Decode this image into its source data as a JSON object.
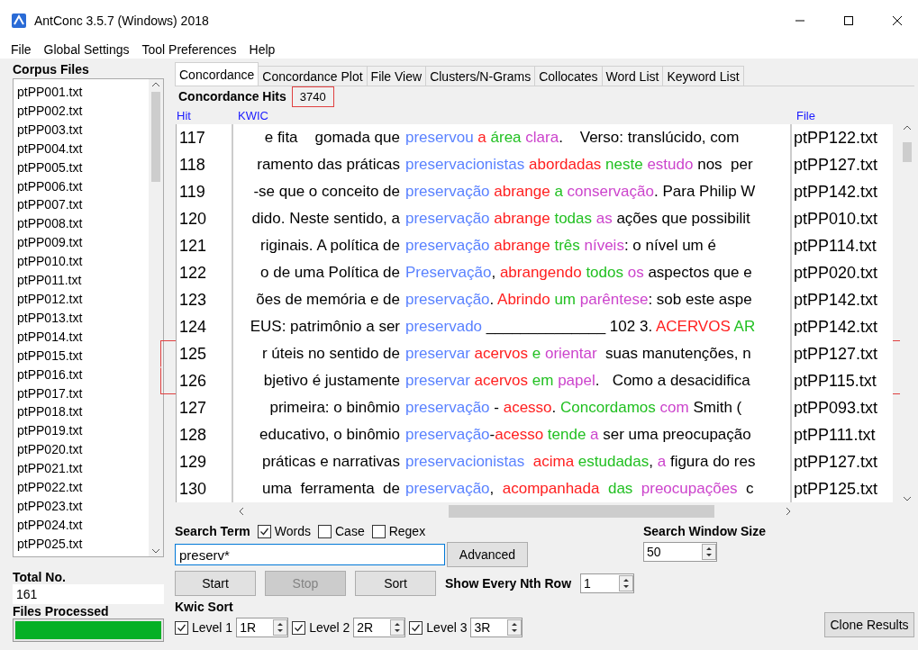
{
  "window": {
    "title": "AntConc 3.5.7 (Windows) 2018"
  },
  "menu": [
    "File",
    "Global Settings",
    "Tool Preferences",
    "Help"
  ],
  "corpus": {
    "title": "Corpus Files",
    "files": [
      "ptPP001.txt",
      "ptPP002.txt",
      "ptPP003.txt",
      "ptPP004.txt",
      "ptPP005.txt",
      "ptPP006.txt",
      "ptPP007.txt",
      "ptPP008.txt",
      "ptPP009.txt",
      "ptPP010.txt",
      "ptPP011.txt",
      "ptPP012.txt",
      "ptPP013.txt",
      "ptPP014.txt",
      "ptPP015.txt",
      "ptPP016.txt",
      "ptPP017.txt",
      "ptPP018.txt",
      "ptPP019.txt",
      "ptPP020.txt",
      "ptPP021.txt",
      "ptPP022.txt",
      "ptPP023.txt",
      "ptPP024.txt",
      "ptPP025.txt"
    ],
    "total_label": "Total No.",
    "total": "161",
    "processed_label": "Files Processed",
    "progress": {
      "level": 1
    }
  },
  "tabs": [
    {
      "label": "Concordance",
      "selected": true
    },
    {
      "label": "Concordance Plot",
      "selected": false
    },
    {
      "label": "File View",
      "selected": false
    },
    {
      "label": "Clusters/N-Grams",
      "selected": false
    },
    {
      "label": "Collocates",
      "selected": false
    },
    {
      "label": "Word List",
      "selected": false
    },
    {
      "label": "Keyword List",
      "selected": false
    }
  ],
  "hits": {
    "label": "Concordance Hits",
    "count": "3740",
    "highlighted": true
  },
  "columns": [
    "Hit",
    "KWIC",
    "File"
  ],
  "rows": [
    {
      "hit": "117",
      "left": "e fita    gomada que",
      "right": [
        {
          "text": "preservou ",
          "color": "#5a82ff"
        },
        {
          "text": "a ",
          "color": "#ff2020"
        },
        {
          "text": "área ",
          "color": "#22c022"
        },
        {
          "text": "clara",
          "color": "#cc44cc"
        },
        {
          "text": ".    Verso: translúcido, com"
        }
      ],
      "file": "ptPP122.txt",
      "highlighted": false
    },
    {
      "hit": "118",
      "left": "ramento das práticas",
      "right": [
        {
          "text": "preservacionistas ",
          "color": "#5a82ff"
        },
        {
          "text": "abordadas ",
          "color": "#ff2020"
        },
        {
          "text": "neste ",
          "color": "#22c022"
        },
        {
          "text": "estudo",
          "color": "#cc44cc"
        },
        {
          "text": " nos  per"
        }
      ],
      "file": "ptPP127.txt",
      "highlighted": false
    },
    {
      "hit": "119",
      "left": "-se que o conceito de",
      "right": [
        {
          "text": "preservação ",
          "color": "#5a82ff"
        },
        {
          "text": "abrange ",
          "color": "#ff2020"
        },
        {
          "text": "a ",
          "color": "#22c022"
        },
        {
          "text": "conservação",
          "color": "#cc44cc"
        },
        {
          "text": ". Para Philip W"
        }
      ],
      "file": "ptPP142.txt",
      "highlighted": false
    },
    {
      "hit": "120",
      "left": "dido. Neste sentido, a",
      "right": [
        {
          "text": "preservação ",
          "color": "#5a82ff"
        },
        {
          "text": "abrange ",
          "color": "#ff2020"
        },
        {
          "text": "todas ",
          "color": "#22c022"
        },
        {
          "text": "as",
          "color": "#cc44cc"
        },
        {
          "text": " ações que possibilit"
        }
      ],
      "file": "ptPP010.txt",
      "highlighted": false
    },
    {
      "hit": "121",
      "left": "riginais. A política de",
      "right": [
        {
          "text": "preservação ",
          "color": "#5a82ff"
        },
        {
          "text": "abrange ",
          "color": "#ff2020"
        },
        {
          "text": "três ",
          "color": "#22c022"
        },
        {
          "text": "níveis",
          "color": "#cc44cc"
        },
        {
          "text": ": o nível um é"
        }
      ],
      "file": "ptPP114.txt",
      "highlighted": false
    },
    {
      "hit": "122",
      "left": "o de uma Política de",
      "right": [
        {
          "text": "Preservação",
          "color": "#5a82ff"
        },
        {
          "text": ", "
        },
        {
          "text": "abrangendo ",
          "color": "#ff2020"
        },
        {
          "text": "todos ",
          "color": "#22c022"
        },
        {
          "text": "os",
          "color": "#cc44cc"
        },
        {
          "text": " aspectos que e"
        }
      ],
      "file": "ptPP020.txt",
      "highlighted": false
    },
    {
      "hit": "123",
      "left": "ões de memória e de",
      "right": [
        {
          "text": "preservação",
          "color": "#5a82ff"
        },
        {
          "text": ". "
        },
        {
          "text": "Abrindo ",
          "color": "#ff2020"
        },
        {
          "text": "um ",
          "color": "#22c022"
        },
        {
          "text": "parêntese",
          "color": "#cc44cc"
        },
        {
          "text": ": sob este aspe"
        }
      ],
      "file": "ptPP142.txt",
      "highlighted": false
    },
    {
      "hit": "124",
      "left": "EUS: patrimônio a ser",
      "right": [
        {
          "text": "preservado",
          "color": "#5a82ff"
        },
        {
          "text": " ______________ 102 3. "
        },
        {
          "text": "ACERVOS ",
          "color": "#ff2020"
        },
        {
          "text": "AR",
          "color": "#22c022"
        }
      ],
      "file": "ptPP142.txt",
      "highlighted": false
    },
    {
      "hit": "125",
      "left": "r úteis no sentido de",
      "right": [
        {
          "text": "preservar ",
          "color": "#5a82ff"
        },
        {
          "text": "acervos ",
          "color": "#ff2020"
        },
        {
          "text": "e ",
          "color": "#22c022"
        },
        {
          "text": "orientar",
          "color": "#cc44cc"
        },
        {
          "text": "  suas manutenções, n"
        }
      ],
      "file": "ptPP127.txt",
      "highlighted": true
    },
    {
      "hit": "126",
      "left": "bjetivo é justamente",
      "right": [
        {
          "text": "preservar ",
          "color": "#5a82ff"
        },
        {
          "text": "acervos ",
          "color": "#ff2020"
        },
        {
          "text": "em ",
          "color": "#22c022"
        },
        {
          "text": "papel",
          "color": "#cc44cc"
        },
        {
          "text": ".   Como a desacidifica"
        }
      ],
      "file": "ptPP115.txt",
      "highlighted": true
    },
    {
      "hit": "127",
      "left": "primeira: o binômio",
      "right": [
        {
          "text": "preservação",
          "color": "#5a82ff"
        },
        {
          "text": " - "
        },
        {
          "text": "acesso",
          "color": "#ff2020"
        },
        {
          "text": ". "
        },
        {
          "text": "Concordamos ",
          "color": "#22c022"
        },
        {
          "text": "com",
          "color": "#cc44cc"
        },
        {
          "text": " Smith ("
        }
      ],
      "file": "ptPP093.txt",
      "highlighted": false
    },
    {
      "hit": "128",
      "left": "educativo, o binômio",
      "right": [
        {
          "text": "preservação",
          "color": "#5a82ff"
        },
        {
          "text": "-"
        },
        {
          "text": "acesso ",
          "color": "#ff2020"
        },
        {
          "text": "tende ",
          "color": "#22c022"
        },
        {
          "text": "a",
          "color": "#cc44cc"
        },
        {
          "text": " ser uma preocupação"
        }
      ],
      "file": "ptPP111.txt",
      "highlighted": false
    },
    {
      "hit": "129",
      "left": "práticas e narrativas",
      "right": [
        {
          "text": "preservacionistas  ",
          "color": "#5a82ff"
        },
        {
          "text": "acima ",
          "color": "#ff2020"
        },
        {
          "text": "estudadas",
          "color": "#22c022"
        },
        {
          "text": ", "
        },
        {
          "text": "a",
          "color": "#cc44cc"
        },
        {
          "text": " figura do res"
        }
      ],
      "file": "ptPP127.txt",
      "highlighted": false
    },
    {
      "hit": "130",
      "left": "uma  ferramenta  de",
      "right": [
        {
          "text": "preservação",
          "color": "#5a82ff"
        },
        {
          "text": ",  "
        },
        {
          "text": "acompanhada  ",
          "color": "#ff2020"
        },
        {
          "text": "das  ",
          "color": "#22c022"
        },
        {
          "text": "preocupações",
          "color": "#cc44cc"
        },
        {
          "text": "  c"
        }
      ],
      "file": "ptPP125.txt",
      "highlighted": false
    }
  ],
  "search": {
    "label": "Search Term",
    "options": [
      {
        "label": "Words",
        "checked": true
      },
      {
        "label": "Case",
        "checked": false
      },
      {
        "label": "Regex",
        "checked": false
      }
    ],
    "value": "preserv*",
    "advanced": "Advanced",
    "window_label": "Search Window Size",
    "window_value": "50"
  },
  "buttons": [
    {
      "label": "Start",
      "disabled": false
    },
    {
      "label": "Stop",
      "disabled": true
    },
    {
      "label": "Sort",
      "disabled": false
    }
  ],
  "nth": {
    "label": "Show Every Nth Row",
    "value": "1"
  },
  "kwic_sort": {
    "label": "Kwic Sort",
    "levels": [
      {
        "label": "Level 1",
        "checked": true,
        "value": "1R"
      },
      {
        "label": "Level 2",
        "checked": true,
        "value": "2R"
      },
      {
        "label": "Level 3",
        "checked": true,
        "value": "3R"
      }
    ]
  },
  "clone": "Clone Results"
}
